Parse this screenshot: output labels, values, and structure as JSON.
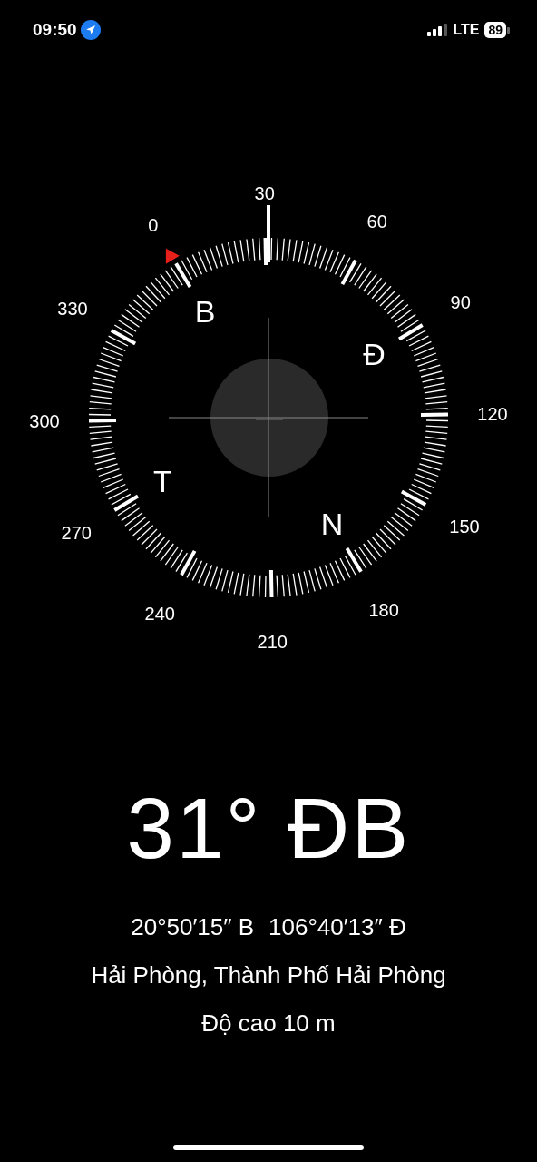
{
  "status_bar": {
    "time": "09:50",
    "location_active": true,
    "network": "LTE",
    "battery": "89"
  },
  "compass": {
    "degree_labels": [
      "0",
      "30",
      "60",
      "90",
      "120",
      "150",
      "180",
      "210",
      "240",
      "270",
      "300",
      "330"
    ],
    "cardinals": [
      "B",
      "Đ",
      "N",
      "T"
    ]
  },
  "heading": "31° ĐB",
  "coordinates": {
    "latitude": "20°50′15″ B",
    "longitude": "106°40′13″ Đ"
  },
  "location": "Hải Phòng, Thành Phố Hải Phòng",
  "altitude": "Độ cao 10 m"
}
